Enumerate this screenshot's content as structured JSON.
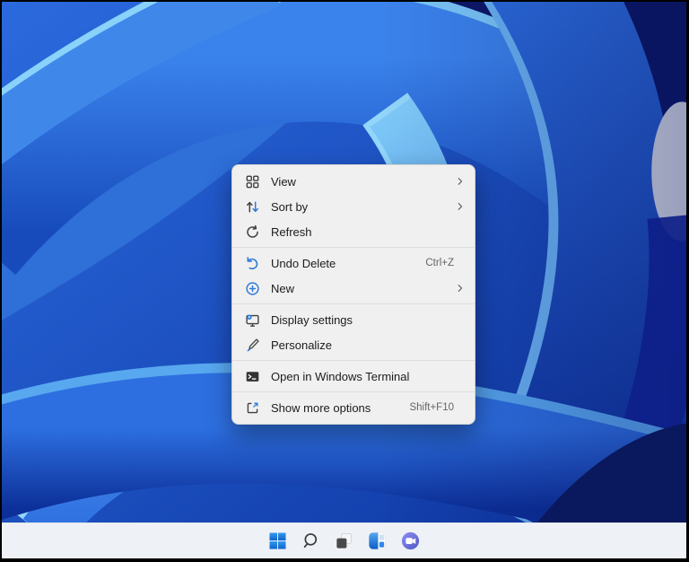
{
  "window": {
    "type": "Windows 11 desktop with right-click context menu",
    "taskbar_style": "light-centered"
  },
  "colors": {
    "accent_blue": "#2f7bd9",
    "menu_bg": "#f0f0f0",
    "menu_text": "#1c1c1c",
    "shortcut_text": "#646464",
    "taskbar_bg": "#eef1f6",
    "wallpaper_primary": "#2b6ade",
    "wallpaper_dark_corner": "#0b1765",
    "wallpaper_highlight": "#7ec9f8",
    "wallpaper_gray_patch": "#d9dee6"
  },
  "context_menu": {
    "groups": [
      {
        "items": [
          {
            "id": "view",
            "label": "View",
            "icon_name": "view-grid-icon",
            "symbol": "i-view",
            "submenu": true
          },
          {
            "id": "sort-by",
            "label": "Sort by",
            "icon_name": "sort-arrows-icon",
            "symbol": "i-sort",
            "submenu": true
          },
          {
            "id": "refresh",
            "label": "Refresh",
            "icon_name": "refresh-icon",
            "symbol": "i-refresh"
          }
        ]
      },
      {
        "items": [
          {
            "id": "undo-delete",
            "label": "Undo Delete",
            "icon_name": "undo-icon",
            "symbol": "i-undo",
            "shortcut": "Ctrl+Z"
          },
          {
            "id": "new",
            "label": "New",
            "icon_name": "new-item-icon",
            "symbol": "i-new",
            "submenu": true
          }
        ]
      },
      {
        "items": [
          {
            "id": "display-settings",
            "label": "Display settings",
            "icon_name": "display-settings-icon",
            "symbol": "i-display"
          },
          {
            "id": "personalize",
            "label": "Personalize",
            "icon_name": "personalize-brush-icon",
            "symbol": "i-brush"
          }
        ]
      },
      {
        "items": [
          {
            "id": "open-in-windows-terminal",
            "label": "Open in Windows Terminal",
            "icon_name": "windows-terminal-icon",
            "symbol": "i-terminal"
          }
        ]
      },
      {
        "items": [
          {
            "id": "show-more-options",
            "label": "Show more options",
            "icon_name": "show-more-options-icon",
            "symbol": "i-more",
            "shortcut": "Shift+F10"
          }
        ]
      }
    ]
  },
  "taskbar": {
    "buttons": [
      {
        "id": "start",
        "name": "start-button",
        "icon_name": "windows-logo-icon",
        "symbol": "i-start"
      },
      {
        "id": "search",
        "name": "search-button",
        "icon_name": "search-icon",
        "symbol": "i-search"
      },
      {
        "id": "task-view",
        "name": "task-view-button",
        "icon_name": "task-view-icon",
        "symbol": "i-taskview"
      },
      {
        "id": "widgets",
        "name": "widgets-button",
        "icon_name": "widgets-icon",
        "symbol": "i-widgets"
      },
      {
        "id": "chat",
        "name": "chat-button",
        "icon_name": "teams-chat-icon",
        "symbol": "i-chat"
      }
    ]
  }
}
